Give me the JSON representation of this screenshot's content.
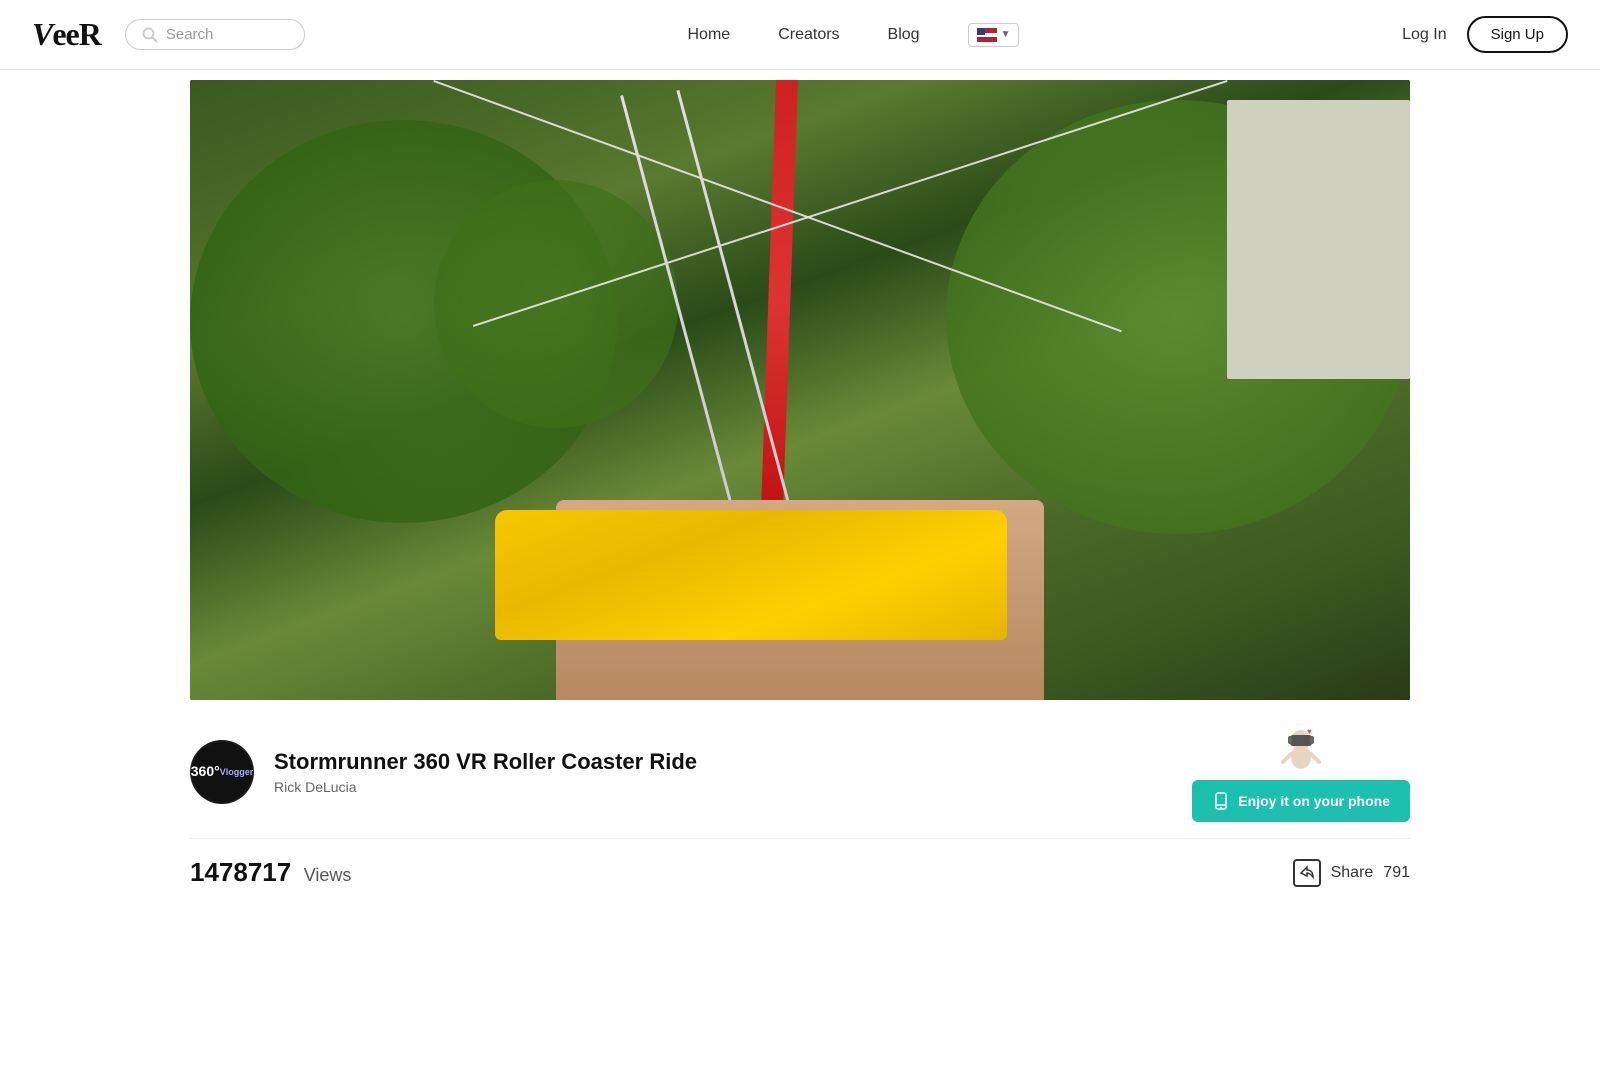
{
  "header": {
    "logo": "VeeR",
    "search_placeholder": "Search",
    "nav": [
      {
        "label": "Home",
        "id": "home"
      },
      {
        "label": "Creators",
        "id": "creators"
      },
      {
        "label": "Blog",
        "id": "blog"
      }
    ],
    "lang_icon": "▼",
    "login_label": "Log In",
    "signup_label": "Sign Up"
  },
  "video": {
    "title": "Stormrunner 360 VR Roller Coaster Ride",
    "author": "Rick DeLucia",
    "avatar_line1": "360°",
    "avatar_line2": "Vlogger",
    "views_count": "1478717",
    "views_label": "Views",
    "share_label": "Share",
    "share_count": "791",
    "enjoy_btn_label": "Enjoy it on your phone"
  }
}
